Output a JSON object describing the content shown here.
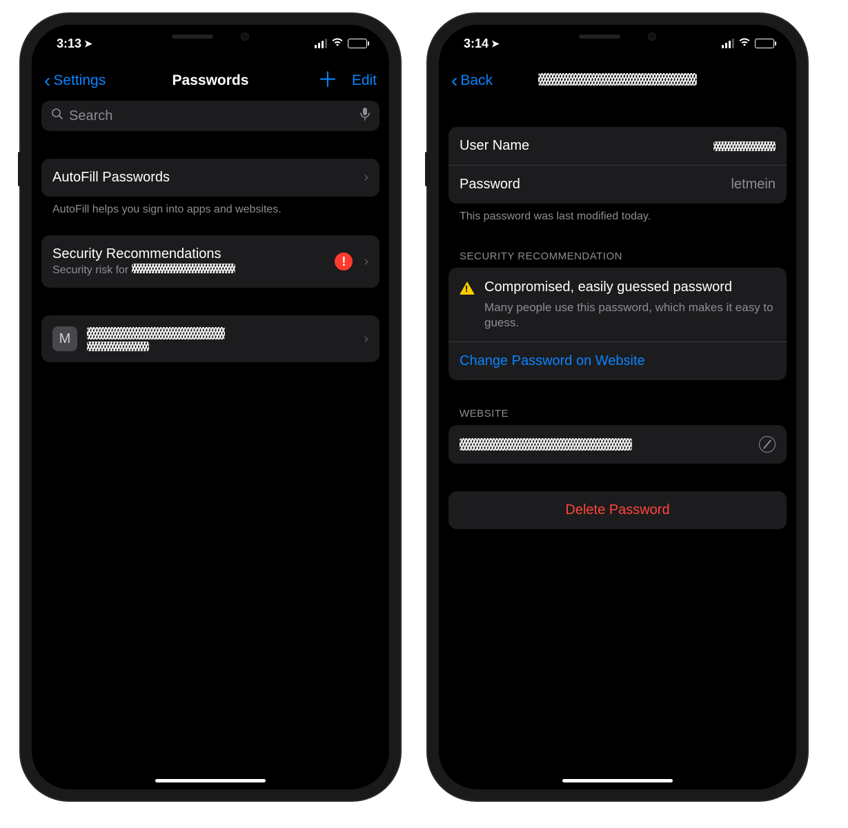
{
  "left": {
    "status_time": "3:13",
    "nav_back": "Settings",
    "nav_title": "Passwords",
    "nav_edit": "Edit",
    "search_placeholder": "Search",
    "autofill": {
      "label": "AutoFill Passwords",
      "footer": "AutoFill helps you sign into apps and websites."
    },
    "security": {
      "label": "Security Recommendations",
      "sub_prefix": "Security risk for "
    },
    "account": {
      "avatar_initial": "M"
    }
  },
  "right": {
    "status_time": "3:14",
    "nav_back": "Back",
    "credentials": {
      "username_label": "User Name",
      "password_label": "Password",
      "password_value": "letmein",
      "modified_footer": "This password was last modified today."
    },
    "recommendation": {
      "header": "SECURITY RECOMMENDATION",
      "title": "Compromised, easily guessed password",
      "desc": "Many people use this password, which makes it easy to guess.",
      "change_link": "Change Password on Website"
    },
    "website": {
      "header": "WEBSITE"
    },
    "delete_label": "Delete Password"
  }
}
